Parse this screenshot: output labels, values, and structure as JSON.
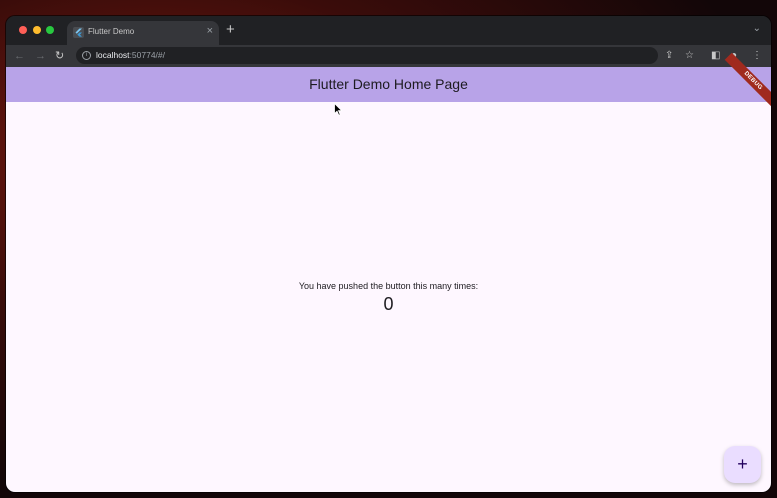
{
  "browser": {
    "tab_title": "Flutter Demo",
    "tab_close": "×",
    "new_tab": "+",
    "tab_menu": "⌄",
    "url_host": "localhost",
    "url_rest": ":50774/#/"
  },
  "app": {
    "title": "Flutter Demo Home Page",
    "debug_banner": "DEBUG",
    "message": "You have pushed the button this many times:",
    "counter": "0",
    "fab_label": "+"
  },
  "colors": {
    "appbar": "#b8a3e8",
    "page_background": "#fef7ff",
    "fab": "#eaddff",
    "debug_banner": "#a02a1e"
  }
}
